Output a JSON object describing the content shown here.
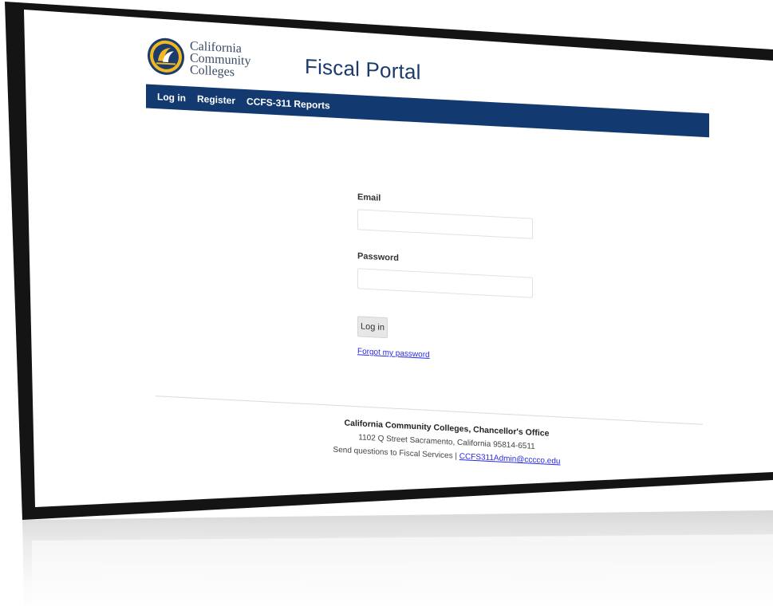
{
  "header": {
    "logo_lines": [
      "California",
      "Community",
      "Colleges"
    ],
    "portal_title": "Fiscal Portal"
  },
  "nav": {
    "items": [
      {
        "label": "Log in"
      },
      {
        "label": "Register"
      },
      {
        "label": "CCFS-311 Reports"
      }
    ]
  },
  "login_form": {
    "email_label": "Email",
    "email_value": "",
    "password_label": "Password",
    "password_value": "",
    "submit_label": "Log in",
    "forgot_link": "Forgot my password"
  },
  "footer": {
    "org": "California Community Colleges, Chancellor's Office",
    "address": "1102 Q Street Sacramento, California 95814-6511",
    "questions_text": "Send questions to Fiscal Services | ",
    "email": "CCFS311Admin@cccco.edu"
  },
  "colors": {
    "navbar": "#133a70",
    "title": "#1c3a6b",
    "link": "#2a2ae0",
    "logo_gold": "#f2b81f",
    "logo_blue": "#1d3c6e"
  }
}
